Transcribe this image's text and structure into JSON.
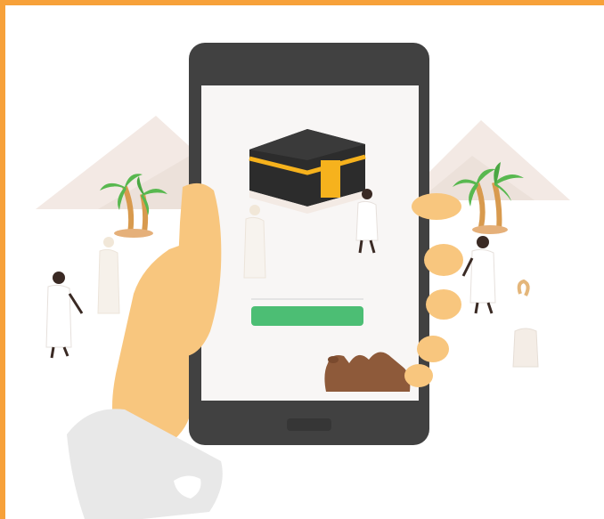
{
  "illustration": {
    "subject": "hand-holding-smartphone",
    "screen_content": "kaaba-with-pilgrims",
    "screen_button_color": "#4cbe74",
    "frame_color": "#f7a13a",
    "colors": {
      "skin": "#f8c67e",
      "phone_body": "#414141",
      "kaaba_cloth": "#2c2c2c",
      "kaaba_gold": "#f6b21d",
      "palm_leaf": "#58b84f",
      "palm_trunk": "#d89a4e",
      "pyramid": "#efe3dc",
      "camel": "#8e5a3a",
      "sleeve": "#e8e8e8"
    },
    "icons": [
      "kaaba-icon",
      "palm-tree-icon",
      "pilgrim-icon",
      "camel-icon"
    ]
  }
}
